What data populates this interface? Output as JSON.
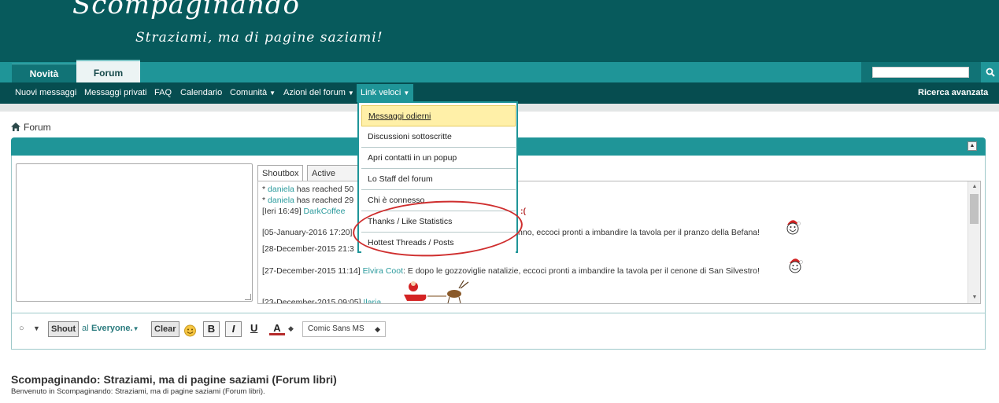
{
  "header": {
    "logo_title": "Scompaginando",
    "logo_subtitle": "Straziami, ma di pagine saziami!"
  },
  "tabs": [
    {
      "label": "Novità",
      "active": false
    },
    {
      "label": "Forum",
      "active": true
    }
  ],
  "search": {
    "placeholder": "",
    "button_icon": "search-icon"
  },
  "navbar": {
    "items": [
      "Nuovi messaggi",
      "Messaggi privati",
      "FAQ",
      "Calendario",
      "Comunità",
      "Azioni del forum",
      "Link veloci"
    ],
    "advanced_search": "Ricerca avanzata"
  },
  "breadcrumb": {
    "label": "Forum"
  },
  "shoutbox": {
    "tabs": [
      "Shoutbox",
      "Active Users"
    ],
    "lines": [
      {
        "prefix": "* ",
        "user": "daniela",
        "text": " has reached 50"
      },
      {
        "prefix": "* ",
        "user": "daniela",
        "text": " has reached 29"
      },
      {
        "prefix": "[Ieri 16:49] ",
        "user": "DarkCoffee",
        "text": ""
      },
      {
        "prefix": "[05-January-2016 17:20] ",
        "user": "",
        "text": "danno, eccoci pronti a imbandire la tavola per il pranzo della Befana!"
      },
      {
        "prefix": "[28-December-2015 21:3",
        "user": "",
        "text": ""
      },
      {
        "prefix": "[27-December-2015 11:14] ",
        "user": "Elvira Coot",
        "text": ": E dopo le gozzoviglie natalizie, eccoci pronti a imbandire la tavola per il cenone di San Silvestro!"
      },
      {
        "prefix": "[23-December-2015 09:05] ",
        "user": "Ilaria",
        "text": ""
      }
    ],
    "partial_red": ":("
  },
  "toolbar": {
    "shout_label": "Shout",
    "to_label": "al",
    "to_target": "Everyone.",
    "clear_label": "Clear",
    "bold_label": "B",
    "italic_label": "I",
    "underline_label": "U",
    "color_label": "A",
    "font_select": "Comic Sans MS"
  },
  "dropdown": {
    "items": [
      "Messaggi odierni",
      "Discussioni sottoscritte",
      "Apri contatti in un popup",
      "Lo Staff del forum",
      "Chi è connesso",
      "Thanks / Like Statistics",
      "Hottest Threads / Posts"
    ]
  },
  "footer": {
    "title": "Scompaginando: Straziami, ma di pagine saziami (Forum libri)",
    "description": "Benvenuto in Scompaginando: Straziami, ma di pagine saziami (Forum libri)."
  },
  "colors": {
    "header_bg": "#075a5c",
    "tabbar_bg": "#1f9598",
    "navbar_bg": "#064d50",
    "highlight": "#fff0a8",
    "annotation": "#cf2e2e"
  }
}
